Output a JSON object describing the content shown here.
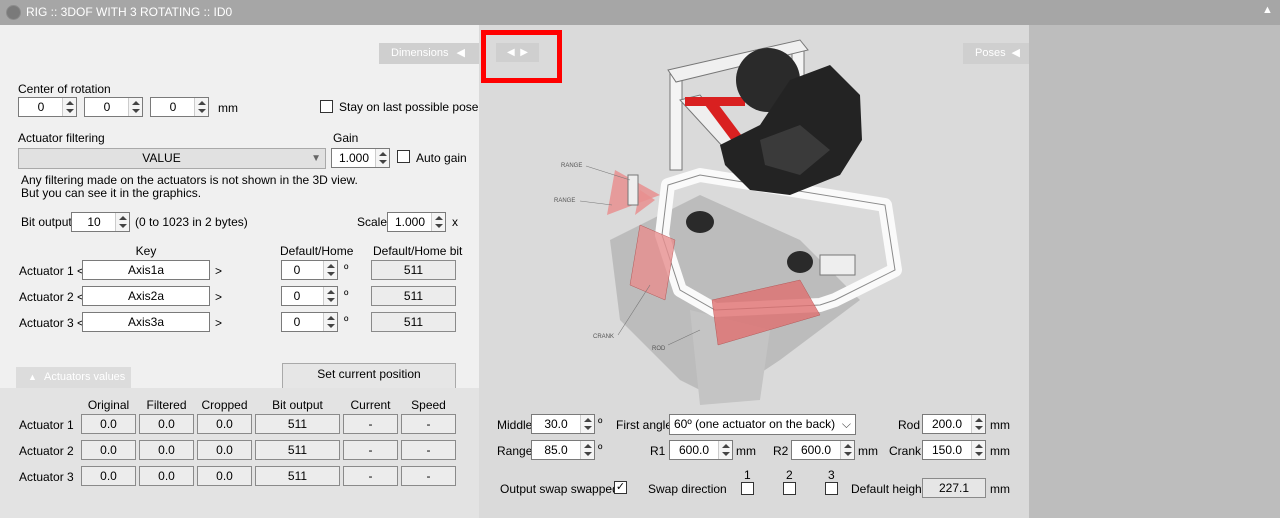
{
  "window": {
    "title": "RIG :: 3DOF WITH 3 ROTATING :: ID0"
  },
  "left": {
    "dimensions_tab": "Dimensions",
    "center_label": "Center of rotation",
    "center_values": [
      "0",
      "0",
      "0"
    ],
    "center_unit": "mm",
    "stay_label": "Stay on last possible pose",
    "filter_label": "Actuator filtering",
    "filter_value": "VALUE",
    "gain_label": "Gain",
    "gain_value": "1.000",
    "auto_gain_label": "Auto gain",
    "filter_note1": "Any filtering made on the actuators is not shown in the 3D view.",
    "filter_note2": "But you can see it in the graphics.",
    "bit_label": "Bit output",
    "bit_value": "10",
    "bit_note": "(0 to 1023 in 2 bytes)",
    "scale_label": "Scale",
    "scale_value": "1.000",
    "scale_unit": "x",
    "col_key": "Key",
    "col_default": "Default/Home",
    "col_default_bit": "Default/Home bit",
    "actuators": [
      {
        "label": "Actuator 1 <",
        "key": "Axis1a",
        "default": "0",
        "bit": "511"
      },
      {
        "label": "Actuator 2 <",
        "key": "Axis2a",
        "default": "0",
        "bit": "511"
      },
      {
        "label": "Actuator 3 <",
        "key": "Axis3a",
        "default": "0",
        "bit": "511"
      }
    ],
    "gt": ">",
    "deg": "º",
    "values_tab": "Actuators values",
    "set_home_button": "Set current position default/home",
    "value_headers": [
      "Original",
      "Filtered",
      "Cropped",
      "Bit output",
      "Current",
      "Speed"
    ],
    "value_rows": [
      {
        "label": "Actuator 1",
        "cells": [
          "0.0",
          "0.0",
          "0.0",
          "511",
          "-",
          "-"
        ]
      },
      {
        "label": "Actuator 2",
        "cells": [
          "0.0",
          "0.0",
          "0.0",
          "511",
          "-",
          "-"
        ]
      },
      {
        "label": "Actuator 3",
        "cells": [
          "0.0",
          "0.0",
          "0.0",
          "511",
          "-",
          "-"
        ]
      }
    ]
  },
  "view": {
    "poses_tab": "Poses",
    "labels": {
      "range1": "RANGE",
      "range2": "RANGE",
      "crank": "CRANK",
      "rod": "ROD"
    }
  },
  "params": {
    "middle_label": "Middle",
    "middle_value": "30.0",
    "range_label": "Range",
    "range_value": "85.0",
    "deg": "º",
    "first_angle_label": "First angle",
    "first_angle_value": "60º (one actuator on the back)",
    "r1_label": "R1",
    "r1_value": "600.0",
    "r2_label": "R2",
    "r2_value": "600.0",
    "mm": "mm",
    "rod_label": "Rod",
    "rod_value": "200.0",
    "crank_label": "Crank",
    "crank_value": "150.0",
    "swap_numbers": [
      "1",
      "2",
      "3"
    ],
    "output_swap_label": "Output swap swapped",
    "swap_dir_label": "Swap direction",
    "default_height_label": "Default height",
    "default_height_value": "227.1"
  },
  "colors": {
    "highlight": "#ff0000",
    "actuator_red": "#d92020",
    "range_red": "#e88f8f"
  }
}
